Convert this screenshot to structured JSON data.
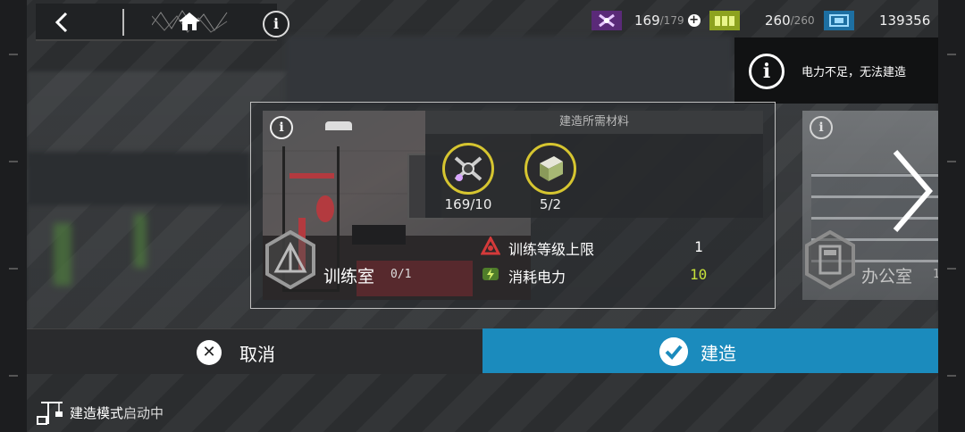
{
  "topbar": {
    "back_icon": "back-arrow-icon",
    "home_icon": "home-icon",
    "info_glyph": "i"
  },
  "resources": [
    {
      "name": "drone-component-icon",
      "value": "169",
      "max": "/179",
      "color": "#a24fd1",
      "has_plus": true
    },
    {
      "name": "battery-icon",
      "value": "260",
      "max": "/260",
      "color": "#b6d13a",
      "has_plus": false
    },
    {
      "name": "data-chip-icon",
      "value": "139356",
      "max": "",
      "color": "#2fa0d8",
      "has_plus": false
    }
  ],
  "warning": {
    "text": "电力不足，无法建造",
    "glyph": "i"
  },
  "room": {
    "name": "训练室",
    "count": "0/1",
    "info_glyph": "i",
    "materials_header": "建造所需材料",
    "materials": [
      {
        "icon": "drone-material-icon",
        "qty": "169/10"
      },
      {
        "icon": "crate-material-icon",
        "qty": "5/2"
      }
    ],
    "stats": [
      {
        "icon": "training-level-icon",
        "label": "训练等级上限",
        "value": "1",
        "color": "#ffffff"
      },
      {
        "icon": "power-consume-icon",
        "label": "消耗电力",
        "value": "10",
        "color": "#c7e13a"
      }
    ]
  },
  "next_room": {
    "name": "办公室",
    "count": "1",
    "info_glyph": "i"
  },
  "buttons": {
    "cancel": "取消",
    "cancel_glyph": "✕",
    "build": "建造"
  },
  "mode": {
    "label_a": "建造模式",
    "label_b": "启动中"
  }
}
